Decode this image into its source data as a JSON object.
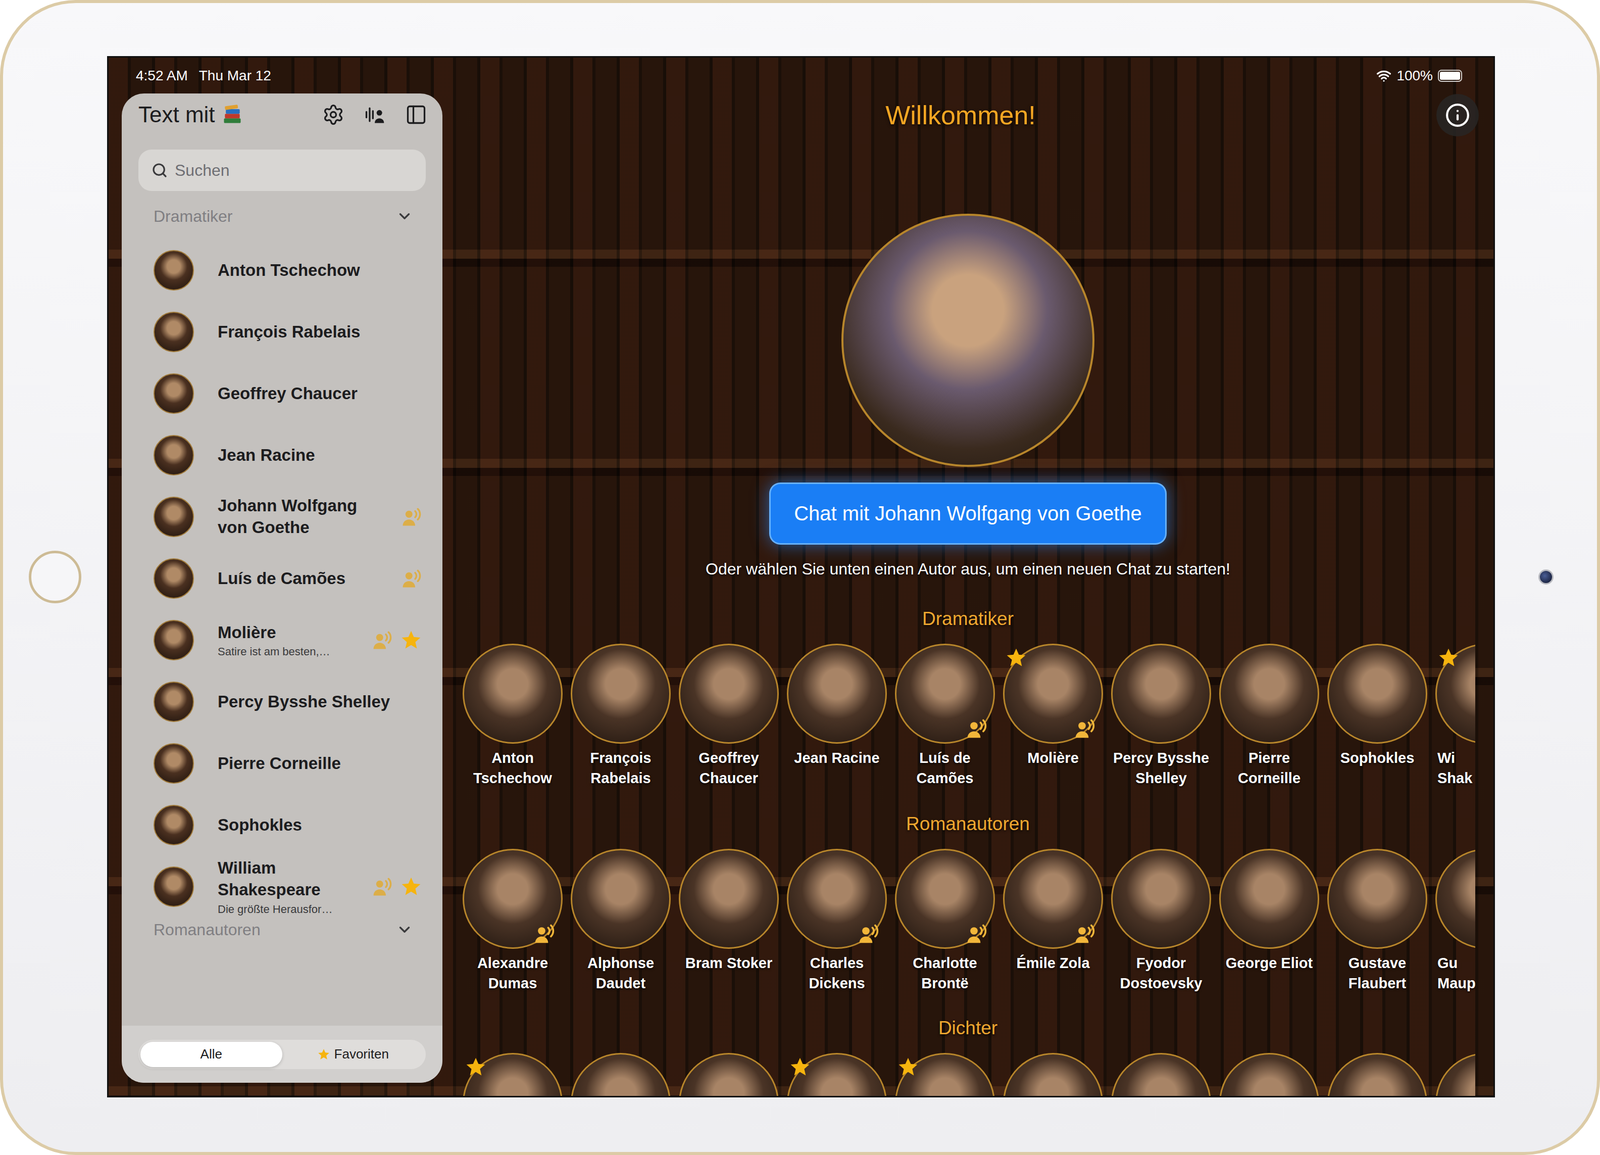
{
  "status_bar": {
    "time": "4:52 AM",
    "date": "Thu Mar 12",
    "battery": "100%",
    "battery_level": 1
  },
  "sidebar": {
    "title": "Text mit",
    "search": {
      "placeholder": "Suchen"
    },
    "sections": [
      {
        "title": "Dramatiker",
        "expanded": true,
        "items": [
          {
            "name": "Anton Tschechow",
            "subtitle": "",
            "voice": false,
            "favorite": false
          },
          {
            "name": "François Rabelais",
            "subtitle": "",
            "voice": false,
            "favorite": false
          },
          {
            "name": "Geoffrey Chaucer",
            "subtitle": "",
            "voice": false,
            "favorite": false
          },
          {
            "name": "Jean Racine",
            "subtitle": "",
            "voice": false,
            "favorite": false
          },
          {
            "name": "Johann Wolfgang von Goethe",
            "subtitle": "",
            "voice": true,
            "favorite": false
          },
          {
            "name": "Luís de Camões",
            "subtitle": "",
            "voice": true,
            "favorite": false
          },
          {
            "name": "Molière",
            "subtitle": "Satire ist am besten,…",
            "voice": true,
            "favorite": true
          },
          {
            "name": "Percy Bysshe Shelley",
            "subtitle": "",
            "voice": false,
            "favorite": false
          },
          {
            "name": "Pierre Corneille",
            "subtitle": "",
            "voice": false,
            "favorite": false
          },
          {
            "name": "Sophokles",
            "subtitle": "",
            "voice": false,
            "favorite": false
          },
          {
            "name": "William Shakespeare",
            "subtitle": "Die größte Herausfor…",
            "voice": true,
            "favorite": true
          }
        ]
      },
      {
        "title": "Romanautoren",
        "expanded": true,
        "items": []
      }
    ],
    "filter": [
      {
        "label": "Alle",
        "selected": true,
        "kind": "plain"
      },
      {
        "label": "Favoriten",
        "selected": false,
        "kind": "star"
      }
    ]
  },
  "main": {
    "title": "Willkommen!",
    "chat_button": "Chat mit Johann Wolfgang von Goethe",
    "hint": "Oder wählen Sie unten einen Autor aus, um einen neuen Chat zu starten!",
    "categories": [
      {
        "title": "Dramatiker",
        "authors": [
          {
            "name": "Anton Tschechow",
            "voice": false,
            "favorite": false,
            "partial": false
          },
          {
            "name": "François Rabelais",
            "voice": false,
            "favorite": false,
            "partial": false
          },
          {
            "name": "Geoffrey Chaucer",
            "voice": false,
            "favorite": false,
            "partial": false
          },
          {
            "name": "Jean Racine",
            "voice": false,
            "favorite": false,
            "partial": false
          },
          {
            "name": "Luís de Camões",
            "voice": true,
            "favorite": false,
            "partial": false
          },
          {
            "name": "Molière",
            "voice": true,
            "favorite": true,
            "partial": false
          },
          {
            "name": "Percy Bysshe Shelley",
            "voice": false,
            "favorite": false,
            "partial": false
          },
          {
            "name": "Pierre Corneille",
            "voice": false,
            "favorite": false,
            "partial": false
          },
          {
            "name": "Sophokles",
            "voice": false,
            "favorite": false,
            "partial": false
          },
          {
            "name": "Wi Shak",
            "voice": false,
            "favorite": true,
            "partial": true
          }
        ]
      },
      {
        "title": "Romanautoren",
        "authors": [
          {
            "name": "Alexandre Dumas",
            "voice": true,
            "favorite": false,
            "partial": false
          },
          {
            "name": "Alphonse Daudet",
            "voice": false,
            "favorite": false,
            "partial": false
          },
          {
            "name": "Bram Stoker",
            "voice": false,
            "favorite": false,
            "partial": false
          },
          {
            "name": "Charles Dickens",
            "voice": true,
            "favorite": false,
            "partial": false
          },
          {
            "name": "Charlotte Brontë",
            "voice": true,
            "favorite": false,
            "partial": false
          },
          {
            "name": "Émile Zola",
            "voice": true,
            "favorite": false,
            "partial": false
          },
          {
            "name": "Fyodor Dostoevsky",
            "voice": false,
            "favorite": false,
            "partial": false
          },
          {
            "name": "George Eliot",
            "voice": false,
            "favorite": false,
            "partial": false
          },
          {
            "name": "Gustave Flaubert",
            "voice": false,
            "favorite": false,
            "partial": false
          },
          {
            "name": "Gu Maup",
            "voice": false,
            "favorite": false,
            "partial": true
          }
        ]
      },
      {
        "title": "Dichter",
        "authors": [
          {
            "voice": false,
            "favorite": true,
            "partial": false
          },
          {
            "voice": false,
            "favorite": false,
            "partial": false
          },
          {
            "voice": false,
            "favorite": false,
            "partial": false
          },
          {
            "voice": false,
            "favorite": true,
            "partial": false
          },
          {
            "voice": false,
            "favorite": true,
            "partial": false
          },
          {
            "voice": false,
            "favorite": false,
            "partial": false
          },
          {
            "voice": false,
            "favorite": false,
            "partial": false
          },
          {
            "voice": false,
            "favorite": false,
            "partial": false
          },
          {
            "voice": false,
            "favorite": false,
            "partial": false
          },
          {
            "voice": false,
            "favorite": false,
            "partial": true
          }
        ]
      }
    ]
  }
}
